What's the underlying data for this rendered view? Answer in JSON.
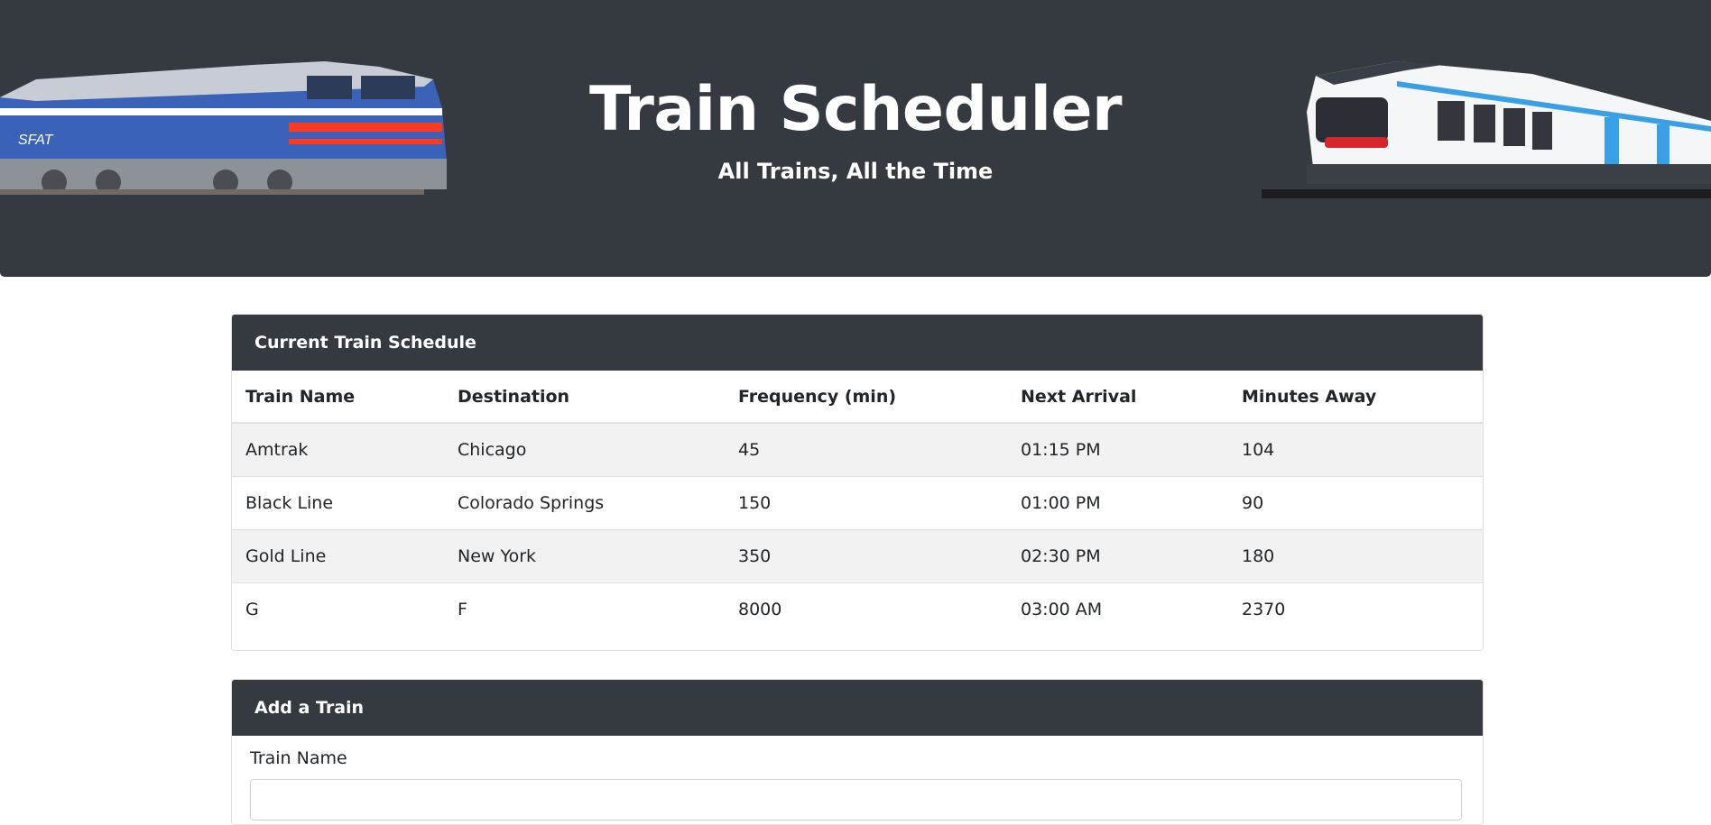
{
  "header": {
    "title": "Train Scheduler",
    "subtitle": "All Trains, All the Time",
    "left_image": "blue-diesel-locomotive-image",
    "right_image": "white-electric-train-image"
  },
  "schedule": {
    "heading": "Current Train Schedule",
    "columns": [
      "Train Name",
      "Destination",
      "Frequency (min)",
      "Next Arrival",
      "Minutes Away"
    ],
    "rows": [
      [
        "Amtrak",
        "Chicago",
        "45",
        "01:15 PM",
        "104"
      ],
      [
        "Black Line",
        "Colorado Springs",
        "150",
        "01:00 PM",
        "90"
      ],
      [
        "Gold Line",
        "New York",
        "350",
        "02:30 PM",
        "180"
      ],
      [
        "G",
        "F",
        "8000",
        "03:00 AM",
        "2370"
      ]
    ]
  },
  "add_train": {
    "heading": "Add a Train",
    "train_name_label": "Train Name",
    "train_name_value": ""
  },
  "colors": {
    "dark": "#343a40",
    "stripe": "#f2f2f2"
  }
}
